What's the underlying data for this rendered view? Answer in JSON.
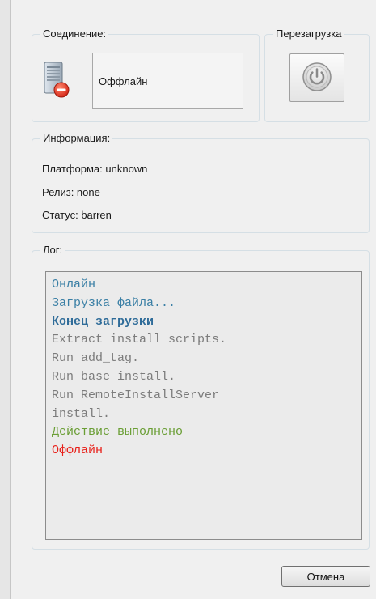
{
  "connection": {
    "title": "Соединение:",
    "status_text": "Оффлайн",
    "icon": "server-offline-icon"
  },
  "reboot": {
    "title": "Перезагрузка",
    "icon": "power-icon"
  },
  "info": {
    "title": "Информация:",
    "platform": "Платформа: unknown",
    "release": "Релиз: none",
    "status": "Статус: barren"
  },
  "log": {
    "title": "Лог:",
    "lines": [
      {
        "text": "Онлайн",
        "color": "#3a7fa5",
        "bold": false
      },
      {
        "text": "Загрузка файла...",
        "color": "#3a7fa5",
        "bold": false
      },
      {
        "text": "Конец загрузки",
        "color": "#2f6c99",
        "bold": true
      },
      {
        "text": "Extract install scripts.",
        "color": "#7c7c7c",
        "bold": false
      },
      {
        "text": "Run add_tag.",
        "color": "#7c7c7c",
        "bold": false
      },
      {
        "text": "Run base install.",
        "color": "#7c7c7c",
        "bold": false
      },
      {
        "text": "Run RemoteInstallServer",
        "color": "#7c7c7c",
        "bold": false
      },
      {
        "text": "install.",
        "color": "#7c7c7c",
        "bold": false
      },
      {
        "text": "Действие выполнено",
        "color": "#6a9e35",
        "bold": false
      },
      {
        "text": "Оффлайн",
        "color": "#e8201a",
        "bold": false
      }
    ]
  },
  "buttons": {
    "cancel_label": "Отмена"
  }
}
